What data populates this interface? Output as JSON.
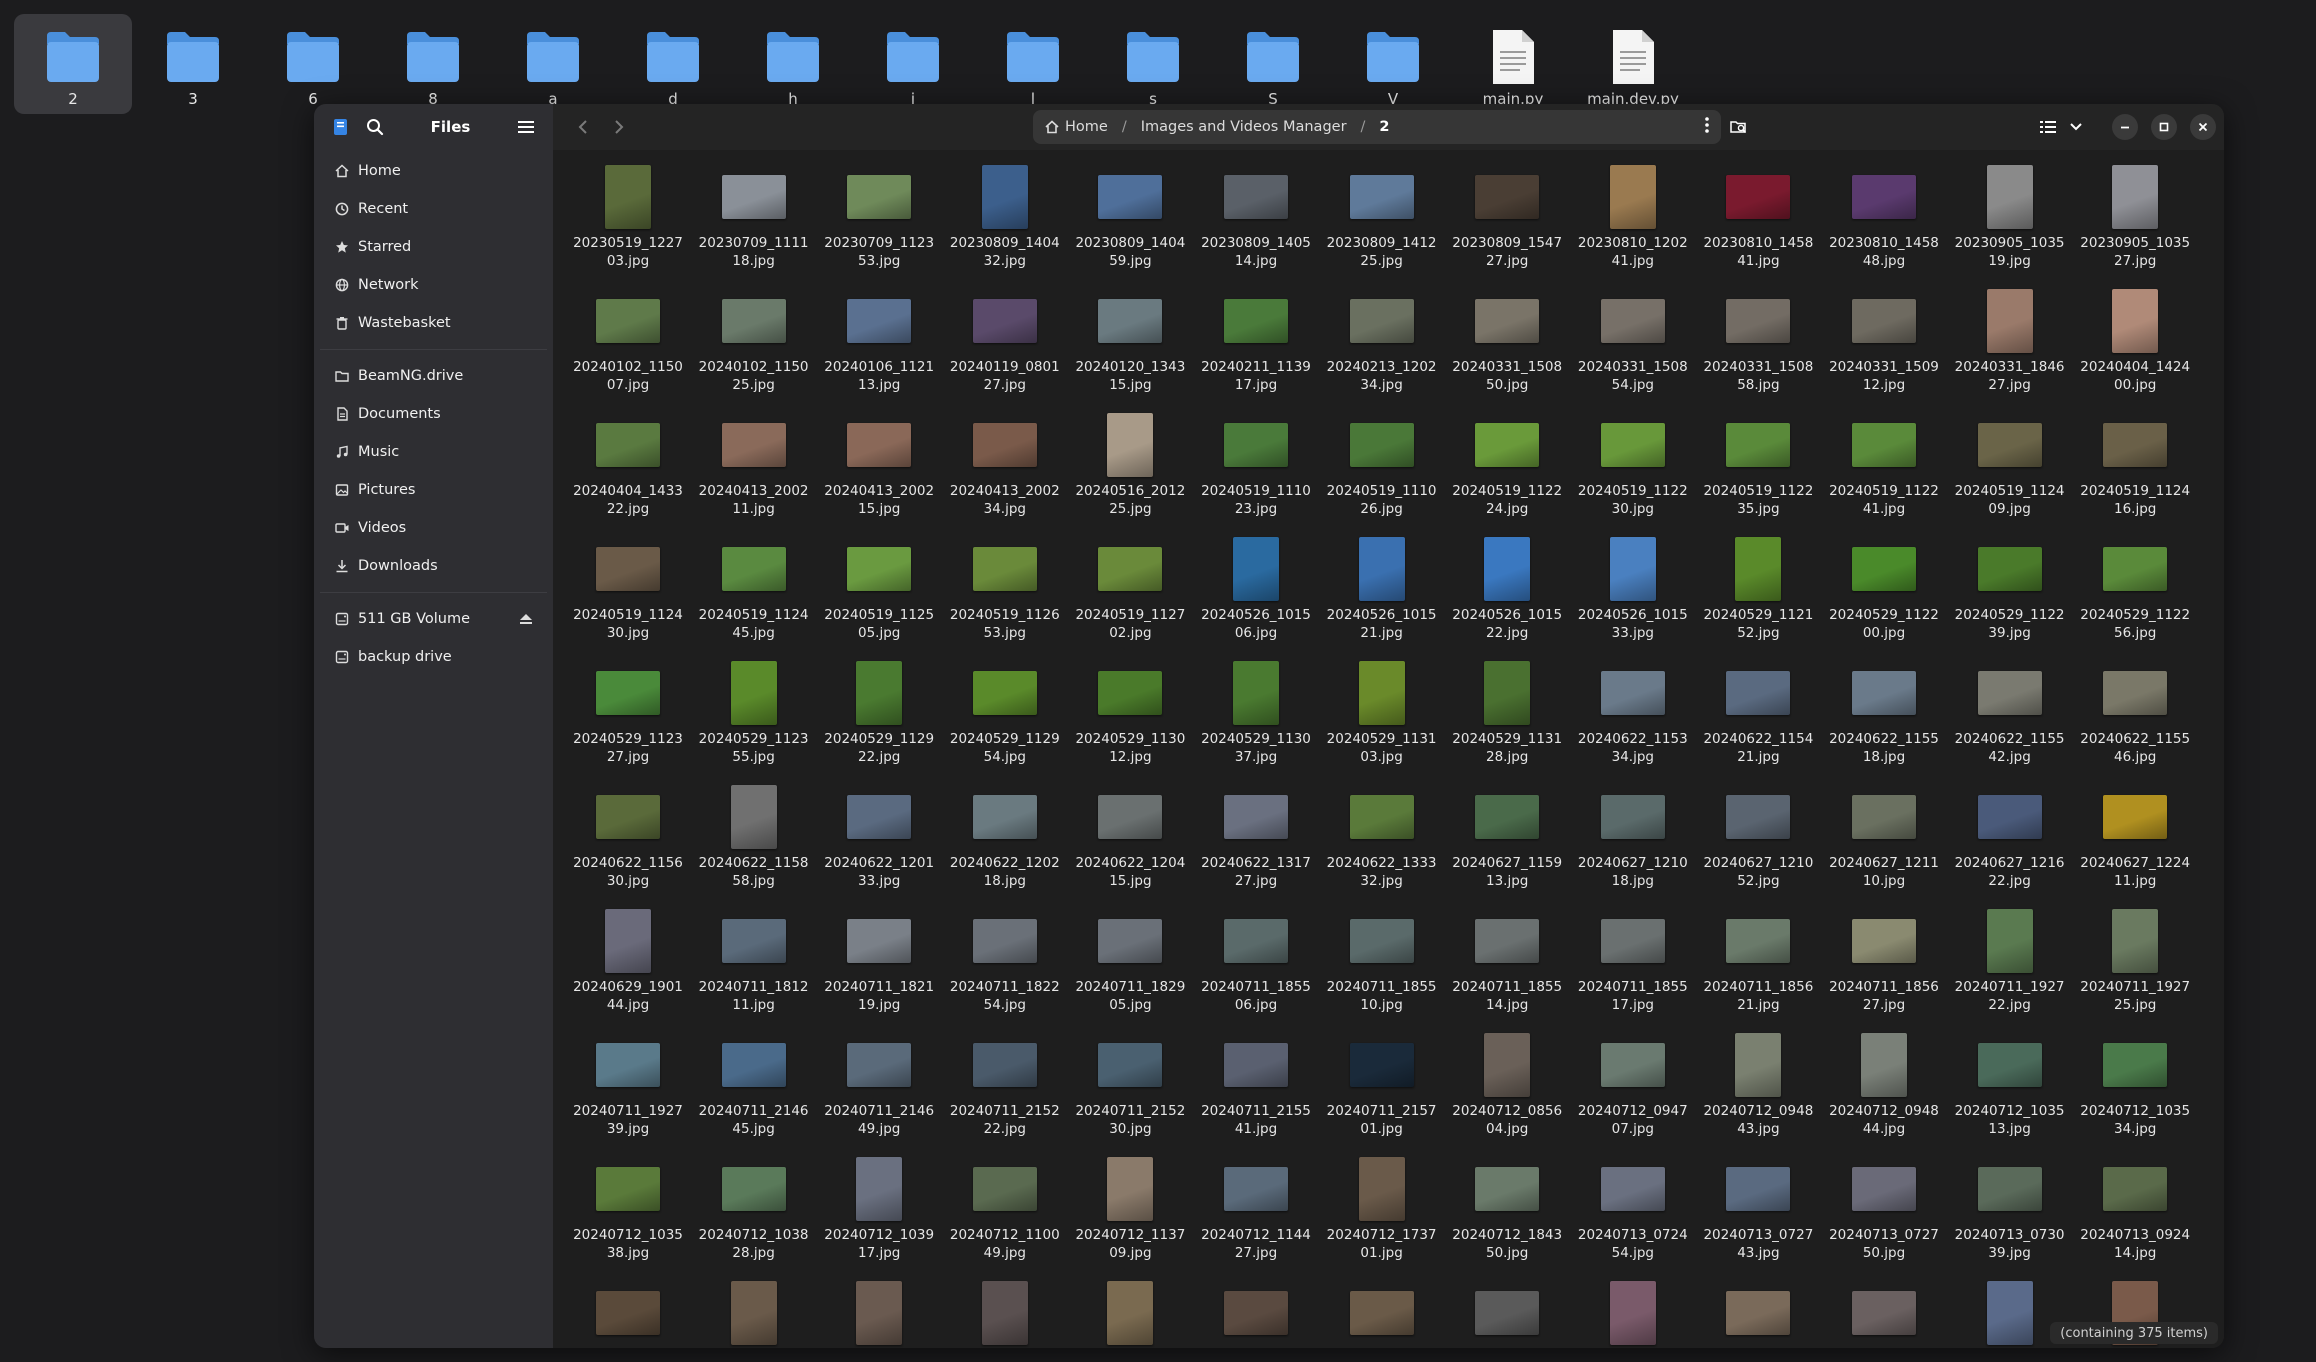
{
  "desktop": {
    "items": [
      {
        "label": "2",
        "type": "folder",
        "selected": true
      },
      {
        "label": "3",
        "type": "folder"
      },
      {
        "label": "6",
        "type": "folder"
      },
      {
        "label": "8",
        "type": "folder"
      },
      {
        "label": "a",
        "type": "folder"
      },
      {
        "label": "d",
        "type": "folder"
      },
      {
        "label": "h",
        "type": "folder"
      },
      {
        "label": "i",
        "type": "folder"
      },
      {
        "label": "l",
        "type": "folder"
      },
      {
        "label": "s",
        "type": "folder"
      },
      {
        "label": "S",
        "type": "folder"
      },
      {
        "label": "V",
        "type": "folder"
      },
      {
        "label": "main.py",
        "type": "file"
      },
      {
        "label": "main.dev.py",
        "type": "file"
      }
    ]
  },
  "sidebar": {
    "title": "Files",
    "places": [
      {
        "label": "Home",
        "icon": "home-icon"
      },
      {
        "label": "Recent",
        "icon": "clock-icon"
      },
      {
        "label": "Starred",
        "icon": "star-icon"
      },
      {
        "label": "Network",
        "icon": "network-icon"
      },
      {
        "label": "Wastebasket",
        "icon": "trash-icon"
      }
    ],
    "bookmarks": [
      {
        "label": "BeamNG.drive",
        "icon": "folder-icon"
      },
      {
        "label": "Documents",
        "icon": "document-icon"
      },
      {
        "label": "Music",
        "icon": "music-icon"
      },
      {
        "label": "Pictures",
        "icon": "picture-icon"
      },
      {
        "label": "Videos",
        "icon": "video-icon"
      },
      {
        "label": "Downloads",
        "icon": "download-icon"
      }
    ],
    "devices": [
      {
        "label": "511 GB Volume",
        "icon": "drive-icon",
        "eject": true
      },
      {
        "label": "backup drive",
        "icon": "drive-icon"
      }
    ]
  },
  "path": {
    "crumbs": [
      {
        "label": "Home"
      },
      {
        "label": "Images and Videos Manager"
      },
      {
        "label": "2"
      }
    ]
  },
  "status": {
    "text": "(containing 375 items)"
  },
  "files": [
    {
      "name": "20230519_122703.jpg",
      "o": "p",
      "c": "#5a6a3a"
    },
    {
      "name": "20230709_111118.jpg",
      "o": "l",
      "c": "#8a9098"
    },
    {
      "name": "20230709_112353.jpg",
      "o": "l",
      "c": "#6f8a5a"
    },
    {
      "name": "20230809_140432.jpg",
      "o": "p",
      "c": "#3c5f8c"
    },
    {
      "name": "20230809_140459.jpg",
      "o": "l",
      "c": "#4f6f9a"
    },
    {
      "name": "20230809_140514.jpg",
      "o": "l",
      "c": "#5a6068"
    },
    {
      "name": "20230809_141225.jpg",
      "o": "l",
      "c": "#5f7a9a"
    },
    {
      "name": "20230809_154727.jpg",
      "o": "l",
      "c": "#4a3e34"
    },
    {
      "name": "20230810_120241.jpg",
      "o": "p",
      "c": "#9a7a50"
    },
    {
      "name": "20230810_145841.jpg",
      "o": "l",
      "c": "#7a1a2e"
    },
    {
      "name": "20230810_145848.jpg",
      "o": "l",
      "c": "#5a3a6e"
    },
    {
      "name": "20230905_103519.jpg",
      "o": "p",
      "c": "#8a8a8a"
    },
    {
      "name": "20230905_103527.jpg",
      "o": "p",
      "c": "#8f9096"
    },
    {
      "name": "20240102_115007.jpg",
      "o": "l",
      "c": "#5f7a4a"
    },
    {
      "name": "20240102_115025.jpg",
      "o": "l",
      "c": "#6a7a6a"
    },
    {
      "name": "20240106_112113.jpg",
      "o": "l",
      "c": "#5a7090"
    },
    {
      "name": "20240119_080127.jpg",
      "o": "l",
      "c": "#5a4a6a"
    },
    {
      "name": "20240120_134315.jpg",
      "o": "l",
      "c": "#6a7a80"
    },
    {
      "name": "20240211_113917.jpg",
      "o": "l",
      "c": "#4a7a3a"
    },
    {
      "name": "20240213_120234.jpg",
      "o": "l",
      "c": "#6a7060"
    },
    {
      "name": "20240331_150850.jpg",
      "o": "l",
      "c": "#7a7468"
    },
    {
      "name": "20240331_150854.jpg",
      "o": "l",
      "c": "#777068"
    },
    {
      "name": "20240331_150858.jpg",
      "o": "l",
      "c": "#736c64"
    },
    {
      "name": "20240331_150912.jpg",
      "o": "l",
      "c": "#6e6a60"
    },
    {
      "name": "20240331_184627.jpg",
      "o": "p",
      "c": "#9a7a6a"
    },
    {
      "name": "20240404_142400.jpg",
      "o": "p",
      "c": "#b08a78"
    },
    {
      "name": "20240404_143322.jpg",
      "o": "l",
      "c": "#5a7a40"
    },
    {
      "name": "20240413_200211.jpg",
      "o": "l",
      "c": "#8a6a5a"
    },
    {
      "name": "20240413_200215.jpg",
      "o": "l",
      "c": "#8a6858"
    },
    {
      "name": "20240413_200234.jpg",
      "o": "l",
      "c": "#7a5a4a"
    },
    {
      "name": "20240516_201225.jpg",
      "o": "p",
      "c": "#a89a88"
    },
    {
      "name": "20240519_111023.jpg",
      "o": "l",
      "c": "#4a7a3a"
    },
    {
      "name": "20240519_111026.jpg",
      "o": "l",
      "c": "#4a7838"
    },
    {
      "name": "20240519_112224.jpg",
      "o": "l",
      "c": "#6a9a3a"
    },
    {
      "name": "20240519_112230.jpg",
      "o": "l",
      "c": "#68983a"
    },
    {
      "name": "20240519_112235.jpg",
      "o": "l",
      "c": "#5a8a3a"
    },
    {
      "name": "20240519_112241.jpg",
      "o": "l",
      "c": "#5a8a3a"
    },
    {
      "name": "20240519_112409.jpg",
      "o": "l",
      "c": "#6a6448"
    },
    {
      "name": "20240519_112416.jpg",
      "o": "l",
      "c": "#6a6048"
    },
    {
      "name": "20240519_112430.jpg",
      "o": "l",
      "c": "#6a5a48"
    },
    {
      "name": "20240519_112445.jpg",
      "o": "l",
      "c": "#5a8a40"
    },
    {
      "name": "20240519_112505.jpg",
      "o": "l",
      "c": "#6a9a40"
    },
    {
      "name": "20240519_112653.jpg",
      "o": "l",
      "c": "#6a8a3a"
    },
    {
      "name": "20240519_112702.jpg",
      "o": "l",
      "c": "#6a8a3a"
    },
    {
      "name": "20240526_101506.jpg",
      "o": "p",
      "c": "#2a6aa0"
    },
    {
      "name": "20240526_101521.jpg",
      "o": "p",
      "c": "#3a70b0"
    },
    {
      "name": "20240526_101522.jpg",
      "o": "p",
      "c": "#3a78c0"
    },
    {
      "name": "20240526_101533.jpg",
      "o": "p",
      "c": "#4a80c0"
    },
    {
      "name": "20240529_112152.jpg",
      "o": "p",
      "c": "#5a8a2a"
    },
    {
      "name": "20240529_112200.jpg",
      "o": "l",
      "c": "#4a8a2a"
    },
    {
      "name": "20240529_112239.jpg",
      "o": "l",
      "c": "#4a7a2a"
    },
    {
      "name": "20240529_112256.jpg",
      "o": "l",
      "c": "#5a8a3a"
    },
    {
      "name": "20240529_112327.jpg",
      "o": "l",
      "c": "#4a8a3a"
    },
    {
      "name": "20240529_112355.jpg",
      "o": "p",
      "c": "#5a8a2a"
    },
    {
      "name": "20240529_112922.jpg",
      "o": "p",
      "c": "#4a7a30"
    },
    {
      "name": "20240529_112954.jpg",
      "o": "l",
      "c": "#5a8a2a"
    },
    {
      "name": "20240529_113012.jpg",
      "o": "l",
      "c": "#4a7a2a"
    },
    {
      "name": "20240529_113037.jpg",
      "o": "p",
      "c": "#4a7a30"
    },
    {
      "name": "20240529_113103.jpg",
      "o": "p",
      "c": "#6a8a2a"
    },
    {
      "name": "20240529_113128.jpg",
      "o": "p",
      "c": "#4a7030"
    },
    {
      "name": "20240622_115334.jpg",
      "o": "l",
      "c": "#6a7a8a"
    },
    {
      "name": "20240622_115421.jpg",
      "o": "l",
      "c": "#5a6a80"
    },
    {
      "name": "20240622_115518.jpg",
      "o": "l",
      "c": "#6a7a8a"
    },
    {
      "name": "20240622_115542.jpg",
      "o": "l",
      "c": "#7a7a70"
    },
    {
      "name": "20240622_115546.jpg",
      "o": "l",
      "c": "#7a7868"
    },
    {
      "name": "20240622_115630.jpg",
      "o": "l",
      "c": "#5a6a3a"
    },
    {
      "name": "20240622_115858.jpg",
      "o": "p",
      "c": "#707070"
    },
    {
      "name": "20240622_120133.jpg",
      "o": "l",
      "c": "#5a6a80"
    },
    {
      "name": "20240622_120218.jpg",
      "o": "l",
      "c": "#6a7a80"
    },
    {
      "name": "20240622_120415.jpg",
      "o": "l",
      "c": "#6a7070"
    },
    {
      "name": "20240622_131727.jpg",
      "o": "l",
      "c": "#6a7080"
    },
    {
      "name": "20240622_133332.jpg",
      "o": "l",
      "c": "#5a7a3a"
    },
    {
      "name": "20240627_115913.jpg",
      "o": "l",
      "c": "#4a6a4a"
    },
    {
      "name": "20240627_121018.jpg",
      "o": "l",
      "c": "#5a6a6a"
    },
    {
      "name": "20240627_121052.jpg",
      "o": "l",
      "c": "#5a6470"
    },
    {
      "name": "20240627_121110.jpg",
      "o": "l",
      "c": "#6a7060"
    },
    {
      "name": "20240627_121622.jpg",
      "o": "l",
      "c": "#4a5a7a"
    },
    {
      "name": "20240627_122411.jpg",
      "o": "l",
      "c": "#b09020"
    },
    {
      "name": "20240629_190144.jpg",
      "o": "p",
      "c": "#6a6a7a"
    },
    {
      "name": "20240711_181211.jpg",
      "o": "l",
      "c": "#5a6a7a"
    },
    {
      "name": "20240711_182119.jpg",
      "o": "l",
      "c": "#7a8088"
    },
    {
      "name": "20240711_182254.jpg",
      "o": "l",
      "c": "#6a7078"
    },
    {
      "name": "20240711_182905.jpg",
      "o": "l",
      "c": "#6a7078"
    },
    {
      "name": "20240711_185506.jpg",
      "o": "l",
      "c": "#5a6a6a"
    },
    {
      "name": "20240711_185510.jpg",
      "o": "l",
      "c": "#5a6a6a"
    },
    {
      "name": "20240711_185514.jpg",
      "o": "l",
      "c": "#6a7070"
    },
    {
      "name": "20240711_185517.jpg",
      "o": "l",
      "c": "#6a7070"
    },
    {
      "name": "20240711_185621.jpg",
      "o": "l",
      "c": "#6a7a6a"
    },
    {
      "name": "20240711_185627.jpg",
      "o": "l",
      "c": "#8a8a70"
    },
    {
      "name": "20240711_192722.jpg",
      "o": "p",
      "c": "#5a7a50"
    },
    {
      "name": "20240711_192725.jpg",
      "o": "p",
      "c": "#6a7a60"
    },
    {
      "name": "20240711_192739.jpg",
      "o": "l",
      "c": "#5a7a8a"
    },
    {
      "name": "20240711_214645.jpg",
      "o": "l",
      "c": "#4a6a8a"
    },
    {
      "name": "20240711_214649.jpg",
      "o": "l",
      "c": "#5a6a7a"
    },
    {
      "name": "20240711_215222.jpg",
      "o": "l",
      "c": "#4a5a6a"
    },
    {
      "name": "20240711_215230.jpg",
      "o": "l",
      "c": "#4a6070"
    },
    {
      "name": "20240711_215541.jpg",
      "o": "l",
      "c": "#5a6070"
    },
    {
      "name": "20240711_215701.jpg",
      "o": "l",
      "c": "#1a2a3a"
    },
    {
      "name": "20240712_085604.jpg",
      "o": "p",
      "c": "#6a6058"
    },
    {
      "name": "20240712_094707.jpg",
      "o": "l",
      "c": "#6a7a70"
    },
    {
      "name": "20240712_094843.jpg",
      "o": "p",
      "c": "#7a8070"
    },
    {
      "name": "20240712_094844.jpg",
      "o": "p",
      "c": "#7a8078"
    },
    {
      "name": "20240712_103513.jpg",
      "o": "l",
      "c": "#4a6a5a"
    },
    {
      "name": "20240712_103534.jpg",
      "o": "l",
      "c": "#4a7a4a"
    },
    {
      "name": "20240712_103538.jpg",
      "o": "l",
      "c": "#5a7a3a"
    },
    {
      "name": "20240712_103828.jpg",
      "o": "l",
      "c": "#5a7a5a"
    },
    {
      "name": "20240712_103917.jpg",
      "o": "p",
      "c": "#6a7080"
    },
    {
      "name": "20240712_110049.jpg",
      "o": "l",
      "c": "#5a6a50"
    },
    {
      "name": "20240712_113709.jpg",
      "o": "p",
      "c": "#8a7a6a"
    },
    {
      "name": "20240712_114427.jpg",
      "o": "l",
      "c": "#5a6a7a"
    },
    {
      "name": "20240712_173701.jpg",
      "o": "p",
      "c": "#6a5a4a"
    },
    {
      "name": "20240712_184350.jpg",
      "o": "l",
      "c": "#6a7a6a"
    },
    {
      "name": "20240713_072454.jpg",
      "o": "l",
      "c": "#6a7080"
    },
    {
      "name": "20240713_072743.jpg",
      "o": "l",
      "c": "#5a6a80"
    },
    {
      "name": "20240713_072750.jpg",
      "o": "l",
      "c": "#6a6a78"
    },
    {
      "name": "20240713_073039.jpg",
      "o": "l",
      "c": "#5a6a5a"
    },
    {
      "name": "20240713_092414.jpg",
      "o": "l",
      "c": "#5a6a4a"
    },
    {
      "name": "",
      "o": "l",
      "c": "#5a4a3a"
    },
    {
      "name": "",
      "o": "p",
      "c": "#6a5a4a"
    },
    {
      "name": "",
      "o": "p",
      "c": "#6a5a50"
    },
    {
      "name": "",
      "o": "p",
      "c": "#5a5050"
    },
    {
      "name": "",
      "o": "p",
      "c": "#7a6a50"
    },
    {
      "name": "",
      "o": "l",
      "c": "#5a4a40"
    },
    {
      "name": "",
      "o": "l",
      "c": "#6a5a48"
    },
    {
      "name": "",
      "o": "l",
      "c": "#5a5a5a"
    },
    {
      "name": "",
      "o": "p",
      "c": "#7a5a6a"
    },
    {
      "name": "",
      "o": "l",
      "c": "#7a6a5a"
    },
    {
      "name": "",
      "o": "l",
      "c": "#6a6060"
    },
    {
      "name": "",
      "o": "p",
      "c": "#5a6a8a"
    },
    {
      "name": "",
      "o": "p",
      "c": "#7a5a4a"
    }
  ]
}
